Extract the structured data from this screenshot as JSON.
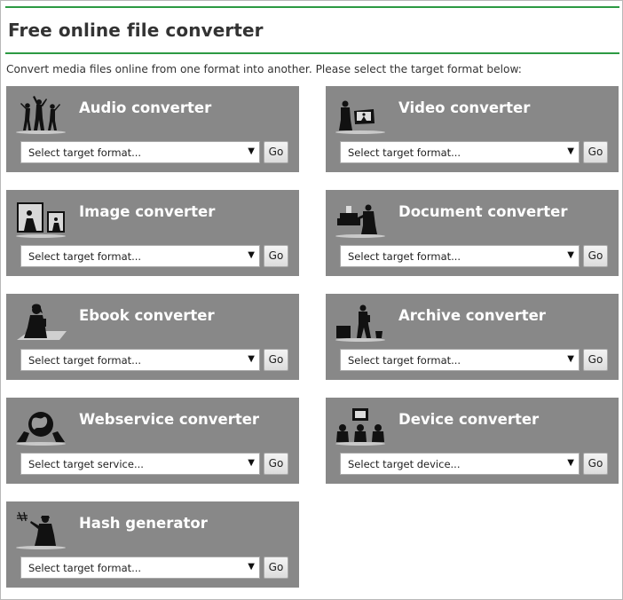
{
  "page": {
    "title": "Free online file converter",
    "intro": "Convert media files online from one format into another. Please select the target format below:"
  },
  "colors": {
    "accent_green": "#2c9a43",
    "card_bg": "#888888"
  },
  "converters": [
    {
      "key": "audio",
      "title": "Audio converter",
      "select": "Select target format...",
      "go": "Go",
      "icon": "dancers-icon"
    },
    {
      "key": "video",
      "title": "Video converter",
      "select": "Select target format...",
      "go": "Go",
      "icon": "video-viewer-icon"
    },
    {
      "key": "image",
      "title": "Image converter",
      "select": "Select target format...",
      "go": "Go",
      "icon": "photo-frames-icon"
    },
    {
      "key": "document",
      "title": "Document converter",
      "select": "Select target format...",
      "go": "Go",
      "icon": "typewriter-icon"
    },
    {
      "key": "ebook",
      "title": "Ebook converter",
      "select": "Select target format...",
      "go": "Go",
      "icon": "ebook-reader-icon"
    },
    {
      "key": "archive",
      "title": "Archive converter",
      "select": "Select target format...",
      "go": "Go",
      "icon": "archive-boxes-icon"
    },
    {
      "key": "webservice",
      "title": "Webservice converter",
      "select": "Select target service...",
      "go": "Go",
      "icon": "globe-hands-icon"
    },
    {
      "key": "device",
      "title": "Device converter",
      "select": "Select target device...",
      "go": "Go",
      "icon": "devices-people-icon"
    },
    {
      "key": "hash",
      "title": "Hash generator",
      "select": "Select target format...",
      "go": "Go",
      "icon": "hash-writer-icon"
    }
  ]
}
